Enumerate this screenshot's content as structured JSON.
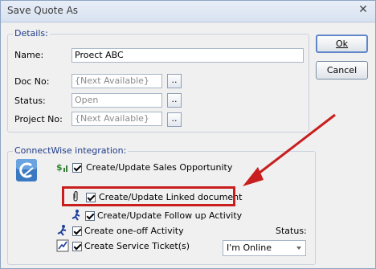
{
  "window": {
    "title": "Save Quote As",
    "close_glyph": "✕"
  },
  "details": {
    "legend": "Details:",
    "name_label": "Name:",
    "name_value": "Proect ABC",
    "doc_no_label": "Doc No:",
    "doc_no_value": "{Next Available}",
    "status_label": "Status:",
    "status_value": "Open",
    "project_no_label": "Project No:",
    "project_no_value": "{Next Available}",
    "ellipsis": ".."
  },
  "buttons": {
    "ok_label": "Ok",
    "cancel_label": "Cancel"
  },
  "connectwise": {
    "legend": "ConnectWise integration:",
    "options": [
      {
        "label": "Create/Update Sales Opportunity",
        "checked": true,
        "icon": "dollar-icon"
      },
      {
        "label": "Create/Update Linked document",
        "checked": true,
        "icon": "paperclip-icon",
        "highlighted": true
      },
      {
        "label": "Create/Update Follow up Activity",
        "checked": true,
        "icon": "activity-icon"
      },
      {
        "label": "Create one-off Activity",
        "checked": true,
        "icon": "running-person-icon"
      },
      {
        "label": "Create Service Ticket(s)",
        "checked": true,
        "icon": "ticket-graph-icon"
      }
    ],
    "status_label": "Status:",
    "status_value": "I'm Online"
  },
  "annotation": {
    "arrow_color": "#c81e1e",
    "highlight_color": "#c81e1e"
  }
}
